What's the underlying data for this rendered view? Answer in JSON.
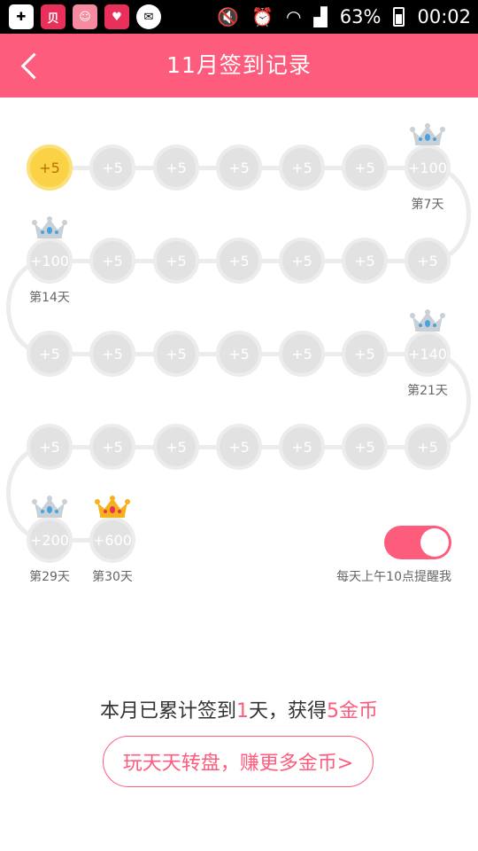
{
  "status_bar": {
    "battery": "63%",
    "time": "00:02",
    "icons": [
      "add-icon",
      "beibei-app-icon",
      "cartoon-app-icon",
      "baby-app-icon",
      "messenger-app-icon",
      "mute-icon",
      "alarm-icon",
      "wifi-icon",
      "signal-icon",
      "battery-icon"
    ]
  },
  "header": {
    "title": "11月签到记录",
    "back_icon": "chevron-left-icon"
  },
  "calendar": {
    "rows": [
      [
        "+5",
        "+5",
        "+5",
        "+5",
        "+5",
        "+5",
        "+100"
      ],
      [
        "+100",
        "+5",
        "+5",
        "+5",
        "+5",
        "+5",
        "+5"
      ],
      [
        "+5",
        "+5",
        "+5",
        "+5",
        "+5",
        "+5",
        "+140"
      ],
      [
        "+5",
        "+5",
        "+5",
        "+5",
        "+5",
        "+5",
        "+5"
      ],
      [
        "+200",
        "+600"
      ]
    ],
    "signed_days": [
      1
    ],
    "milestones": [
      {
        "day": 7,
        "label": "第7天",
        "crown": "silver"
      },
      {
        "day": 14,
        "label": "第14天",
        "crown": "silver"
      },
      {
        "day": 21,
        "label": "第21天",
        "crown": "silver"
      },
      {
        "day": 29,
        "label": "第29天",
        "crown": "silver"
      },
      {
        "day": 30,
        "label": "第30天",
        "crown": "gold"
      }
    ]
  },
  "reminder": {
    "enabled": true,
    "label": "每天上午10点提醒我"
  },
  "summary": {
    "prefix": "本月已累计签到",
    "days": "1",
    "middle": "天，获得",
    "coins": "5",
    "suffix": "金币"
  },
  "cta": {
    "label": "玩天天转盘，赚更多金币>"
  },
  "colors": {
    "accent": "#fd5c7c",
    "coin_signed": "#fbd246",
    "coin_unsigned": "#e2e2e2"
  }
}
